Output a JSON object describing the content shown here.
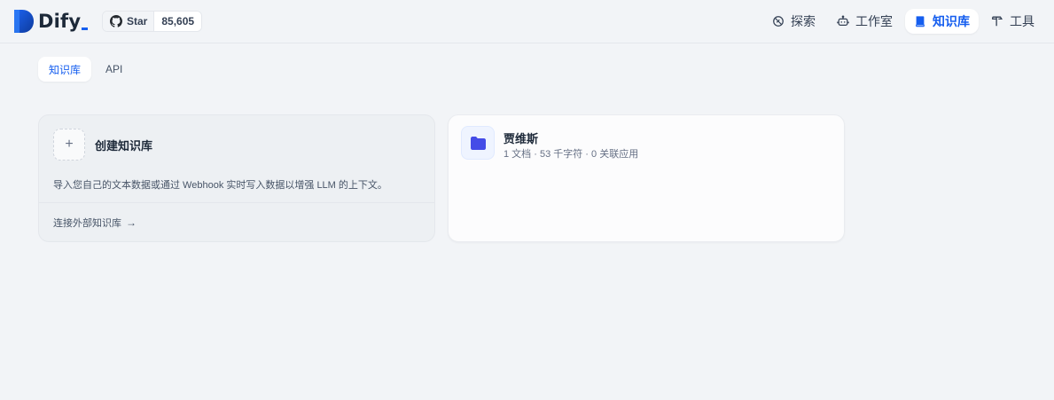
{
  "brand": {
    "name": "Dify"
  },
  "github": {
    "star_label": "Star",
    "star_count": "85,605"
  },
  "nav": {
    "items": [
      {
        "label": "探索",
        "icon": "explore-icon",
        "active": false
      },
      {
        "label": "工作室",
        "icon": "robot-icon",
        "active": false
      },
      {
        "label": "知识库",
        "icon": "book-icon",
        "active": true
      },
      {
        "label": "工具",
        "icon": "hammer-icon",
        "active": false
      }
    ]
  },
  "tabs": [
    {
      "label": "知识库",
      "active": true
    },
    {
      "label": "API",
      "active": false
    }
  ],
  "create_card": {
    "title": "创建知识库",
    "plus": "+",
    "description": "导入您自己的文本数据或通过 Webhook 实时写入数据以增强 LLM 的上下文。",
    "connect_label": "连接外部知识库",
    "connect_arrow": "→"
  },
  "datasets": [
    {
      "name": "贾维斯",
      "meta": "1 文档 · 53 千字符 · 0 关联应用",
      "icon": "folder-icon"
    }
  ],
  "colors": {
    "accent": "#155eef",
    "folder": "#444ce7",
    "background": "#f2f4f7"
  }
}
